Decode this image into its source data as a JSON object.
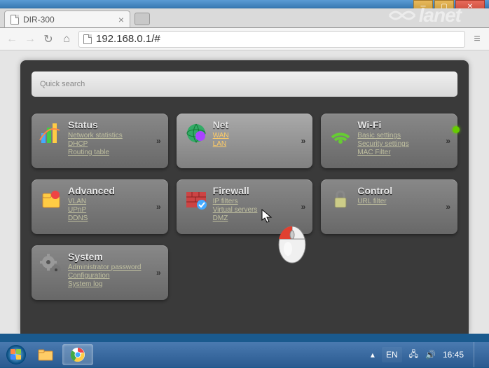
{
  "window": {
    "tab_title": "DIR-300",
    "url": "192.168.0.1/#",
    "watermark": "lanet"
  },
  "search": {
    "placeholder": "Quick search"
  },
  "cards": [
    {
      "title": "Status",
      "links": [
        "Network statistics",
        "DHCP",
        "Routing table"
      ],
      "active": false
    },
    {
      "title": "Net",
      "links": [
        "WAN",
        "LAN"
      ],
      "active": true
    },
    {
      "title": "Wi-Fi",
      "links": [
        "Basic settings",
        "Security settings",
        "MAC Filter"
      ],
      "active": false,
      "dot": true
    },
    {
      "title": "Advanced",
      "links": [
        "VLAN",
        "UPnP",
        "DDNS"
      ],
      "active": false
    },
    {
      "title": "Firewall",
      "links": [
        "IP filters",
        "Virtual servers",
        "DMZ"
      ],
      "active": false
    },
    {
      "title": "Control",
      "links": [
        "URL filter"
      ],
      "active": false
    },
    {
      "title": "System",
      "links": [
        "Administrator password",
        "Configuration",
        "System log"
      ],
      "active": false
    }
  ],
  "taskbar": {
    "lang": "EN",
    "time": "16:45"
  }
}
